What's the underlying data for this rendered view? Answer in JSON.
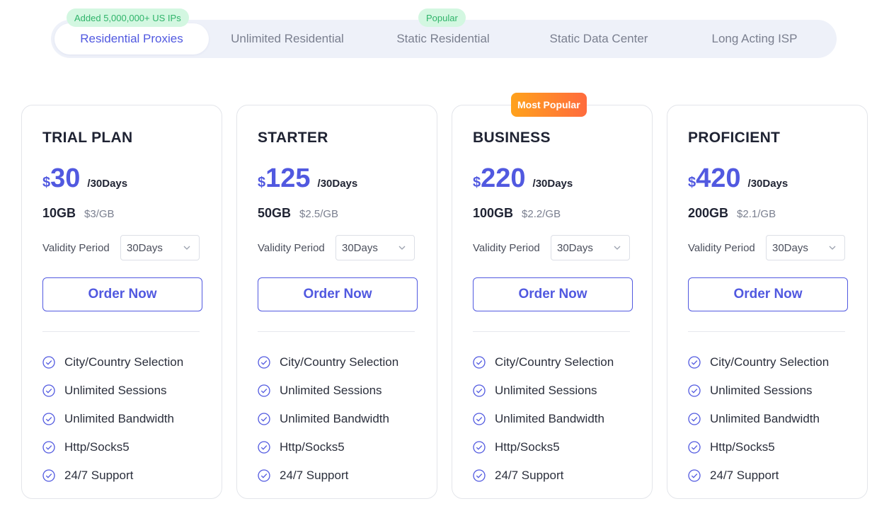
{
  "tabs": [
    {
      "label": "Residential Proxies",
      "active": true,
      "badge": "Added 5,000,000+ US IPs"
    },
    {
      "label": "Unlimited Residential",
      "active": false,
      "badge": ""
    },
    {
      "label": "Static Residential",
      "active": false,
      "badge": "Popular"
    },
    {
      "label": "Static Data Center",
      "active": false,
      "badge": ""
    },
    {
      "label": "Long Acting ISP",
      "active": false,
      "badge": ""
    }
  ],
  "colors": {
    "accent": "#5159e0",
    "badge_green_bg": "#d3f7e1",
    "badge_green_text": "#2fb46a",
    "popular_from": "#ffa21c",
    "popular_to": "#ff6b3d"
  },
  "validity_label": "Validity Period",
  "order_label": "Order Now",
  "currency": "$",
  "period": "/30Days",
  "plans": [
    {
      "name": "TRIAL PLAN",
      "price": "30",
      "gb": "10GB",
      "per_gb": "$3/GB",
      "validity": "30Days",
      "badge": ""
    },
    {
      "name": "STARTER",
      "price": "125",
      "gb": "50GB",
      "per_gb": "$2.5/GB",
      "validity": "30Days",
      "badge": ""
    },
    {
      "name": "BUSINESS",
      "price": "220",
      "gb": "100GB",
      "per_gb": "$2.2/GB",
      "validity": "30Days",
      "badge": "Most Popular"
    },
    {
      "name": "PROFICIENT",
      "price": "420",
      "gb": "200GB",
      "per_gb": "$2.1/GB",
      "validity": "30Days",
      "badge": ""
    }
  ],
  "features": [
    "City/Country Selection",
    "Unlimited Sessions",
    "Unlimited Bandwidth",
    "Http/Socks5",
    "24/7 Support"
  ],
  "icons": {
    "check": "check-circle-icon",
    "chevron": "chevron-down-icon"
  }
}
